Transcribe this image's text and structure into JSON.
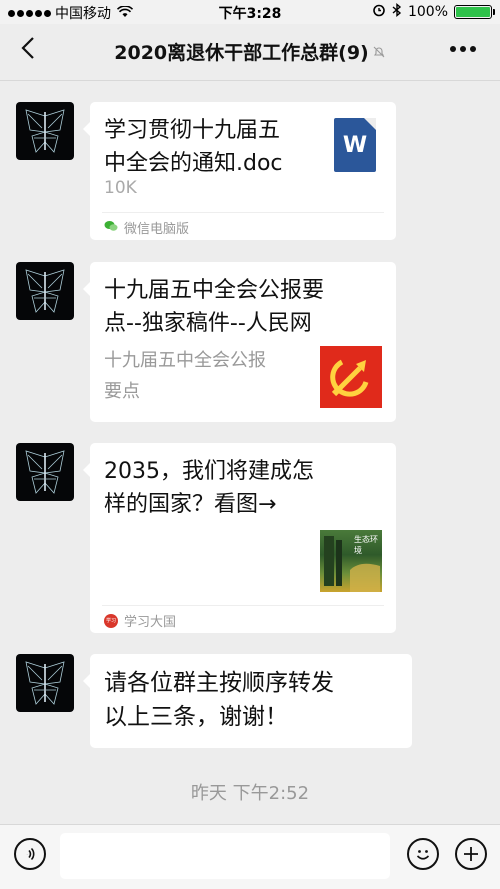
{
  "status_bar": {
    "carrier": "中国移动",
    "time": "下午3:28",
    "battery": "100%",
    "battery_level": 1.0
  },
  "nav": {
    "title": "2020离退休干部工作总群(9)",
    "back_icon": "chevron-left-icon",
    "mute_icon": "bell-muted-icon",
    "more_icon": "ellipsis-icon"
  },
  "messages": [
    {
      "type": "file",
      "title": "学习贯彻十九届五中全会的通知.doc",
      "title_lines": [
        "学习贯彻十九届五",
        "中全会的通知.doc"
      ],
      "size": "10K",
      "source": "微信电脑版",
      "file_icon_letter": "W"
    },
    {
      "type": "link",
      "title_lines": [
        "十九届五中全会公报要",
        "点--独家稿件--人民网"
      ],
      "desc_lines": [
        "十九届五中全会公报",
        "要点"
      ]
    },
    {
      "type": "link",
      "title_lines": [
        "2035，我们将建成怎",
        "样的国家？看图→"
      ],
      "thumb_caption": "生态环境",
      "source": "学习大国",
      "source_badge": "学习"
    },
    {
      "type": "text",
      "lines": [
        "请各位群主按顺序转发",
        "以上三条，谢谢！"
      ]
    }
  ],
  "timestamp": "昨天 下午2:52",
  "input_bar": {
    "voice_icon": "voice-icon",
    "emoji_icon": "emoji-icon",
    "plus_icon": "plus-icon"
  },
  "colors": {
    "background": "#ededed",
    "bubble": "#ffffff",
    "word_blue": "#2b579a",
    "party_red": "#e02a1b",
    "battery_green": "#2ec24a"
  }
}
